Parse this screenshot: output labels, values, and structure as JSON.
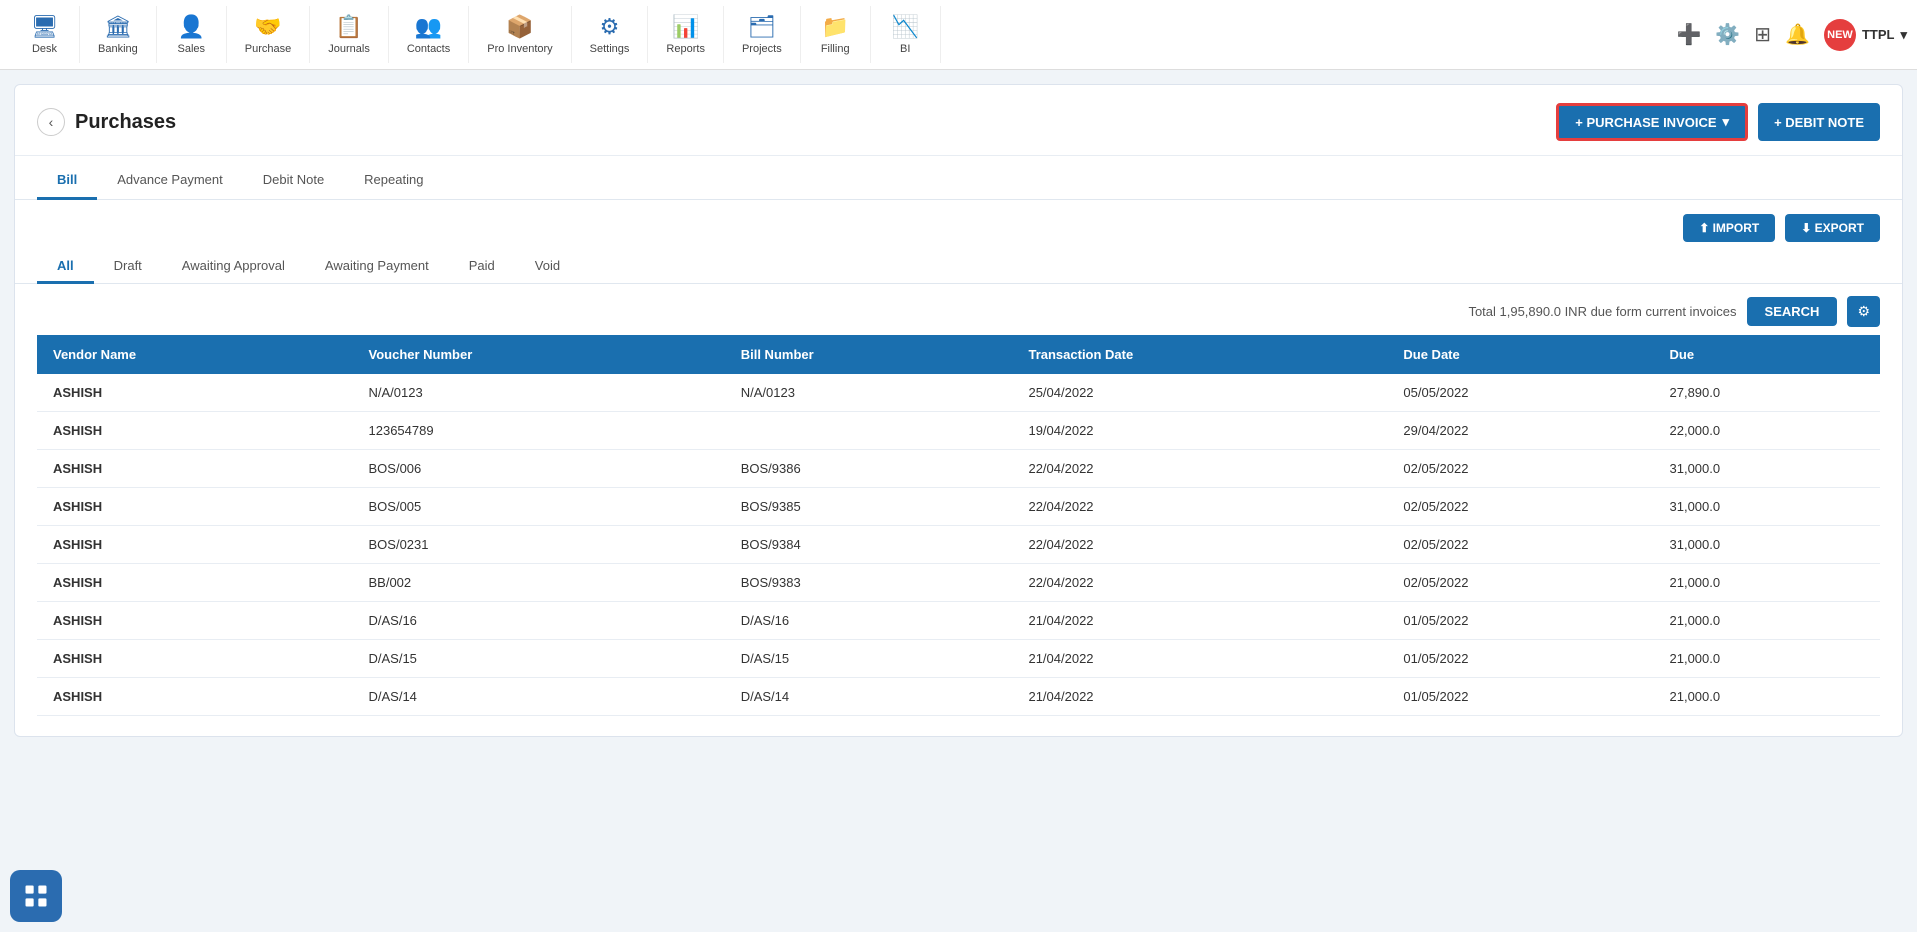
{
  "nav": {
    "items": [
      {
        "label": "Desk",
        "icon": "🖥"
      },
      {
        "label": "Banking",
        "icon": "🏛"
      },
      {
        "label": "Sales",
        "icon": "👤"
      },
      {
        "label": "Purchase",
        "icon": "🤝"
      },
      {
        "label": "Journals",
        "icon": "📋"
      },
      {
        "label": "Contacts",
        "icon": "👥"
      },
      {
        "label": "Pro Inventory",
        "icon": "📦"
      },
      {
        "label": "Settings",
        "icon": "⚙"
      },
      {
        "label": "Reports",
        "icon": "📊"
      },
      {
        "label": "Projects",
        "icon": "🗂"
      },
      {
        "label": "Filling",
        "icon": "📁"
      },
      {
        "label": "BI",
        "icon": "📉"
      }
    ],
    "user_label": "TTPL",
    "new_badge": "NEW"
  },
  "page": {
    "title": "Purchases",
    "back_label": "‹",
    "btn_purchase_invoice": "+ PURCHASE INVOICE",
    "btn_purchase_dropdown": "▾",
    "btn_debit_note": "+ DEBIT NOTE"
  },
  "tabs": [
    {
      "label": "Bill",
      "active": true
    },
    {
      "label": "Advance Payment",
      "active": false
    },
    {
      "label": "Debit Note",
      "active": false
    },
    {
      "label": "Repeating",
      "active": false
    }
  ],
  "toolbar": {
    "import_label": "⬆ IMPORT",
    "export_label": "⬇ EXPORT"
  },
  "filter_tabs": [
    {
      "label": "All",
      "active": true
    },
    {
      "label": "Draft",
      "active": false
    },
    {
      "label": "Awaiting Approval",
      "active": false
    },
    {
      "label": "Awaiting Payment",
      "active": false
    },
    {
      "label": "Paid",
      "active": false
    },
    {
      "label": "Void",
      "active": false
    }
  ],
  "summary": {
    "text": "Total 1,95,890.0 INR due form current invoices",
    "search_label": "SEARCH",
    "settings_icon": "⚙"
  },
  "table": {
    "columns": [
      "Vendor Name",
      "Voucher Number",
      "Bill Number",
      "Transaction Date",
      "Due Date",
      "Due"
    ],
    "rows": [
      {
        "vendor": "ASHISH",
        "voucher": "N/A/0123",
        "bill": "N/A/0123",
        "txn_date": "25/04/2022",
        "due_date": "05/05/2022",
        "due": "27,890.0"
      },
      {
        "vendor": "ASHISH",
        "voucher": "123654789",
        "bill": "",
        "txn_date": "19/04/2022",
        "due_date": "29/04/2022",
        "due": "22,000.0"
      },
      {
        "vendor": "ASHISH",
        "voucher": "BOS/006",
        "bill": "BOS/9386",
        "txn_date": "22/04/2022",
        "due_date": "02/05/2022",
        "due": "31,000.0"
      },
      {
        "vendor": "ASHISH",
        "voucher": "BOS/005",
        "bill": "BOS/9385",
        "txn_date": "22/04/2022",
        "due_date": "02/05/2022",
        "due": "31,000.0"
      },
      {
        "vendor": "ASHISH",
        "voucher": "BOS/0231",
        "bill": "BOS/9384",
        "txn_date": "22/04/2022",
        "due_date": "02/05/2022",
        "due": "31,000.0"
      },
      {
        "vendor": "ASHISH",
        "voucher": "BB/002",
        "bill": "BOS/9383",
        "txn_date": "22/04/2022",
        "due_date": "02/05/2022",
        "due": "21,000.0"
      },
      {
        "vendor": "ASHISH",
        "voucher": "D/AS/16",
        "bill": "D/AS/16",
        "txn_date": "21/04/2022",
        "due_date": "01/05/2022",
        "due": "21,000.0"
      },
      {
        "vendor": "ASHISH",
        "voucher": "D/AS/15",
        "bill": "D/AS/15",
        "txn_date": "21/04/2022",
        "due_date": "01/05/2022",
        "due": "21,000.0"
      },
      {
        "vendor": "ASHISH",
        "voucher": "D/AS/14",
        "bill": "D/AS/14",
        "txn_date": "21/04/2022",
        "due_date": "01/05/2022",
        "due": "21,000.0"
      }
    ]
  }
}
